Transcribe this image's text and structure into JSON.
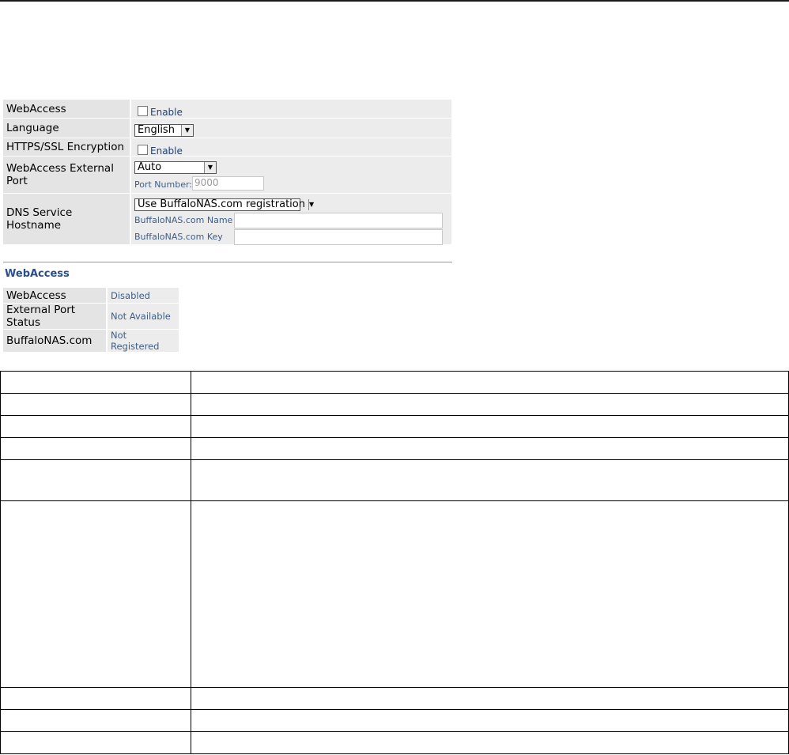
{
  "settings": {
    "webaccess": {
      "label": "WebAccess",
      "checkbox_label": "Enable"
    },
    "language": {
      "label": "Language",
      "selected": "English"
    },
    "https": {
      "label": "HTTPS/SSL Encryption",
      "checkbox_label": "Enable"
    },
    "external_port": {
      "label": "WebAccess External Port",
      "selected": "Auto",
      "port_label": "Port Number:",
      "port_placeholder": "9000"
    },
    "dns": {
      "label": "DNS Service Hostname",
      "selected": "Use BuffaloNAS.com registration",
      "name_label": "BuffaloNAS.com Name",
      "key_label": "BuffaloNAS.com Key"
    }
  },
  "status": {
    "title": "WebAccess",
    "rows": [
      {
        "label": "WebAccess",
        "value": "Disabled"
      },
      {
        "label": "External Port Status",
        "value": "Not Available"
      },
      {
        "label": "BuffaloNAS.com",
        "value": "Not Registered"
      }
    ]
  },
  "icons": {
    "dropdown": "chevron-down-icon",
    "checkbox": "checkbox-icon"
  },
  "colors": {
    "panel_bg": "#e4e4e4",
    "label_blue": "#3d5d8a",
    "title_blue": "#2a4f8a"
  }
}
